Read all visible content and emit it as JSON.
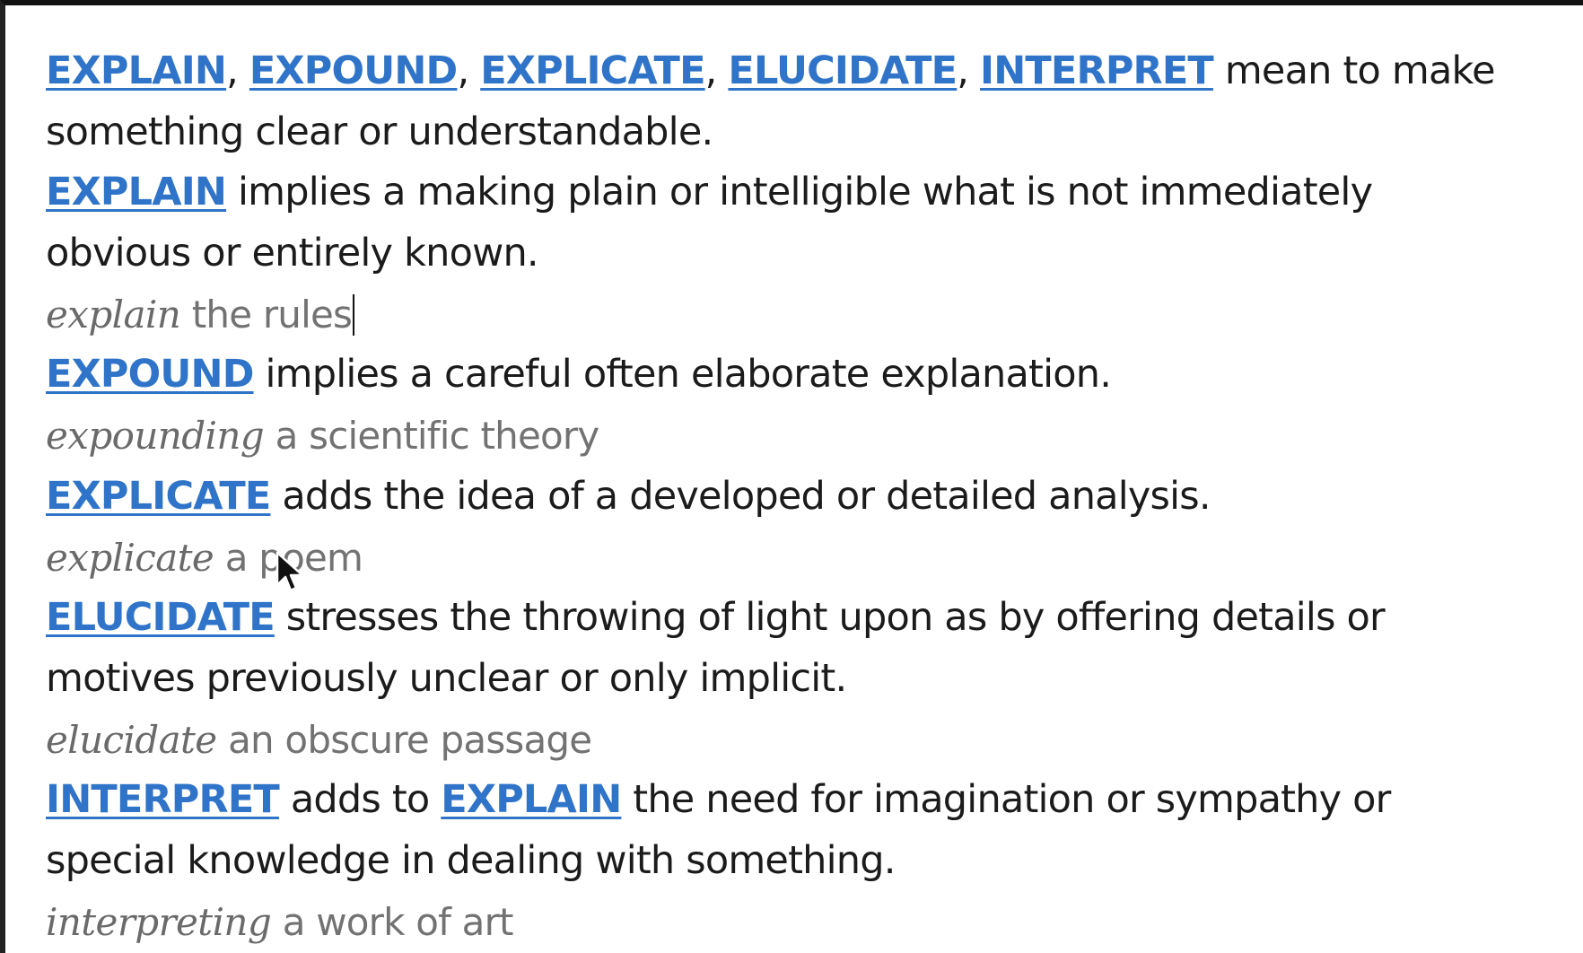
{
  "intro": {
    "terms": [
      "EXPLAIN",
      "EXPOUND",
      "EXPLICATE",
      "ELUCIDATE",
      "INTERPRET"
    ],
    "sep": ",",
    "text_1": "mean to make",
    "text_2": "something clear or understandable."
  },
  "explain": {
    "term": "EXPLAIN",
    "text_1": "implies a making plain or intelligible what is not immediately",
    "text_2": "obvious or entirely known.",
    "example_word": "explain",
    "example_rest": "the rules"
  },
  "expound": {
    "term": "EXPOUND",
    "text_1": "implies a careful often elaborate explanation.",
    "example_word": "expounding",
    "example_rest": "a scientific theory"
  },
  "explicate": {
    "term": "EXPLICATE",
    "text_1": "adds the idea of a developed or detailed analysis.",
    "example_word": "explicate",
    "example_rest": "a poem"
  },
  "elucidate": {
    "term": "ELUCIDATE",
    "text_1": "stresses the throwing of light upon as by offering details or",
    "text_2": "motives previously unclear or only implicit.",
    "example_word": "elucidate",
    "example_rest": "an obscure passage"
  },
  "interpret": {
    "term": "INTERPRET",
    "text_mid": "adds to",
    "ref_term": "EXPLAIN",
    "text_1": "the need for imagination or sympathy or",
    "text_2": "special knowledge in dealing with something.",
    "example_word": "interpreting",
    "example_rest": "a work of art"
  },
  "colors": {
    "link": "#2f74c8",
    "body_text": "#1b1b1b",
    "example_text": "#727272"
  },
  "icons": {
    "cursor": "mouse-pointer-icon",
    "caret": "text-caret"
  }
}
